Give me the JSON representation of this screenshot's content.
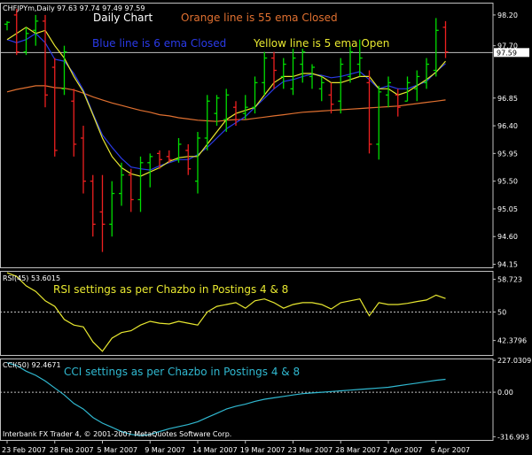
{
  "header": {
    "symbol_info": "CHFJPYm,Daily  97.63 97.74 97.49 97.59",
    "title": "Daily Chart",
    "notes": {
      "orange": "Orange line is 55 ema Closed",
      "blue": "Blue line is 6 ema Closed",
      "yellow": "Yellow line is 5 ema Open"
    }
  },
  "copyright": "Interbank FX Trader 4, © 2001-2007 MetaQuotes Software Corp.",
  "colors": {
    "background": "#000000",
    "up_bar": "#00dd00",
    "down_bar": "#ee2020",
    "ema55": "#e07030",
    "ema6": "#2a3ae8",
    "ema5_open": "#e8e830",
    "rsi": "#e8e830",
    "cci": "#30b8d0",
    "grid": "#c0c0c0",
    "frame": "#c0c0c0",
    "text": "#ffffff"
  },
  "chart_data": [
    {
      "type": "line",
      "title": "Daily Chart",
      "subtitle": "CHFJPYm,Daily  97.63 97.74 97.49 97.59",
      "ylim": [
        94.1,
        98.4
      ],
      "yticks": [
        98.2,
        97.7,
        96.85,
        96.4,
        95.95,
        95.5,
        95.05,
        94.6,
        94.15
      ],
      "ytick_labels": [
        "98.20",
        "97.70",
        "96.85",
        "96.40",
        "95.95",
        "95.50",
        "95.05",
        "94.60",
        "94.15"
      ],
      "current_price": 97.59,
      "current_price_label": "97.59",
      "xtick_labels": [
        {
          "label": "23 Feb 2007",
          "index": 0
        },
        {
          "label": "28 Feb 2007",
          "index": 5
        },
        {
          "label": "5 Mar 2007",
          "index": 10
        },
        {
          "label": "9 Mar 2007",
          "index": 15
        },
        {
          "label": "14 Mar 2007",
          "index": 20
        },
        {
          "label": "19 Mar 2007",
          "index": 25
        },
        {
          "label": "23 Mar 2007",
          "index": 30
        },
        {
          "label": "28 Mar 2007",
          "index": 35
        },
        {
          "label": "2 Apr 2007",
          "index": 40
        },
        {
          "label": "6 Apr 2007",
          "index": 45
        }
      ],
      "ohlc": [
        {
          "open": 98.05,
          "high": 98.1,
          "low": 97.95,
          "close": 98.08
        },
        {
          "open": 98.2,
          "high": 98.3,
          "low": 97.55,
          "close": 97.6
        },
        {
          "open": 97.6,
          "high": 98.0,
          "low": 97.55,
          "close": 97.9
        },
        {
          "open": 97.95,
          "high": 98.2,
          "low": 97.7,
          "close": 98.1
        },
        {
          "open": 98.1,
          "high": 98.2,
          "low": 96.7,
          "close": 96.9
        },
        {
          "open": 97.35,
          "high": 97.5,
          "low": 95.9,
          "close": 96.0
        },
        {
          "open": 97.0,
          "high": 97.7,
          "low": 96.9,
          "close": 97.6
        },
        {
          "open": 96.8,
          "high": 97.0,
          "low": 95.9,
          "close": 96.1
        },
        {
          "open": 96.2,
          "high": 96.4,
          "low": 95.3,
          "close": 95.5
        },
        {
          "open": 95.5,
          "high": 95.6,
          "low": 94.6,
          "close": 94.8
        },
        {
          "open": 95.0,
          "high": 95.6,
          "low": 94.35,
          "close": 94.8
        },
        {
          "open": 94.8,
          "high": 95.5,
          "low": 94.6,
          "close": 95.3
        },
        {
          "open": 95.3,
          "high": 95.8,
          "low": 95.1,
          "close": 95.6
        },
        {
          "open": 95.6,
          "high": 95.7,
          "low": 95.0,
          "close": 95.2
        },
        {
          "open": 95.2,
          "high": 95.9,
          "low": 95.0,
          "close": 95.8
        },
        {
          "open": 95.8,
          "high": 95.95,
          "low": 95.4,
          "close": 95.9
        },
        {
          "open": 95.95,
          "high": 96.0,
          "low": 95.7,
          "close": 95.85
        },
        {
          "open": 95.9,
          "high": 96.0,
          "low": 95.8,
          "close": 95.85
        },
        {
          "open": 95.85,
          "high": 96.2,
          "low": 95.8,
          "close": 96.1
        },
        {
          "open": 96.0,
          "high": 96.1,
          "low": 95.6,
          "close": 95.7
        },
        {
          "open": 95.5,
          "high": 96.3,
          "low": 95.3,
          "close": 96.2
        },
        {
          "open": 96.2,
          "high": 96.9,
          "low": 96.0,
          "close": 96.8
        },
        {
          "open": 96.6,
          "high": 96.9,
          "low": 96.4,
          "close": 96.85
        },
        {
          "open": 96.5,
          "high": 97.0,
          "low": 96.3,
          "close": 96.9
        },
        {
          "open": 96.7,
          "high": 96.8,
          "low": 96.4,
          "close": 96.5
        },
        {
          "open": 96.6,
          "high": 96.9,
          "low": 96.5,
          "close": 96.7
        },
        {
          "open": 96.7,
          "high": 97.2,
          "low": 96.6,
          "close": 97.1
        },
        {
          "open": 97.1,
          "high": 97.6,
          "low": 96.9,
          "close": 97.5
        },
        {
          "open": 97.5,
          "high": 97.6,
          "low": 97.0,
          "close": 97.3
        },
        {
          "open": 97.2,
          "high": 97.5,
          "low": 97.0,
          "close": 97.4
        },
        {
          "open": 97.0,
          "high": 97.65,
          "low": 96.9,
          "close": 97.5
        },
        {
          "open": 97.4,
          "high": 97.65,
          "low": 97.1,
          "close": 97.6
        },
        {
          "open": 97.2,
          "high": 97.4,
          "low": 97.0,
          "close": 97.35
        },
        {
          "open": 97.0,
          "high": 97.2,
          "low": 96.8,
          "close": 97.1
        },
        {
          "open": 96.9,
          "high": 97.1,
          "low": 96.6,
          "close": 96.75
        },
        {
          "open": 96.8,
          "high": 97.5,
          "low": 96.6,
          "close": 97.4
        },
        {
          "open": 97.2,
          "high": 97.7,
          "low": 97.1,
          "close": 97.6
        },
        {
          "open": 97.4,
          "high": 97.8,
          "low": 97.2,
          "close": 97.5
        },
        {
          "open": 97.1,
          "high": 97.3,
          "low": 95.95,
          "close": 96.1
        },
        {
          "open": 96.1,
          "high": 97.05,
          "low": 95.85,
          "close": 96.95
        },
        {
          "open": 96.9,
          "high": 97.2,
          "low": 96.7,
          "close": 97.1
        },
        {
          "open": 96.9,
          "high": 97.0,
          "low": 96.55,
          "close": 96.7
        },
        {
          "open": 96.8,
          "high": 97.2,
          "low": 96.8,
          "close": 97.1
        },
        {
          "open": 97.0,
          "high": 97.3,
          "low": 96.8,
          "close": 97.2
        },
        {
          "open": 97.1,
          "high": 97.5,
          "low": 97.0,
          "close": 97.4
        },
        {
          "open": 97.3,
          "high": 98.15,
          "low": 97.2,
          "close": 97.95
        },
        {
          "open": 98.0,
          "high": 98.1,
          "low": 97.5,
          "close": 97.6
        }
      ],
      "series": [
        {
          "name": "Orange line is 55 ema Closed",
          "values": [
            96.95,
            96.99,
            97.02,
            97.05,
            97.05,
            97.02,
            97.01,
            96.98,
            96.93,
            96.87,
            96.82,
            96.77,
            96.73,
            96.69,
            96.65,
            96.62,
            96.58,
            96.56,
            96.53,
            96.51,
            96.49,
            96.48,
            96.47,
            96.49,
            96.5,
            96.5,
            96.52,
            96.54,
            96.56,
            96.58,
            96.6,
            96.62,
            96.63,
            96.64,
            96.65,
            96.66,
            96.67,
            96.68,
            96.69,
            96.7,
            96.71,
            96.72,
            96.74,
            96.76,
            96.78,
            96.8,
            96.82
          ]
        },
        {
          "name": "Blue line is 6 ema Closed",
          "values": [
            97.8,
            97.75,
            97.8,
            97.9,
            97.75,
            97.48,
            97.45,
            97.25,
            96.98,
            96.6,
            96.25,
            96.05,
            95.87,
            95.73,
            95.7,
            95.68,
            95.75,
            95.8,
            95.85,
            95.85,
            95.93,
            96.05,
            96.2,
            96.35,
            96.45,
            96.55,
            96.7,
            96.85,
            97.0,
            97.12,
            97.15,
            97.2,
            97.24,
            97.22,
            97.18,
            97.2,
            97.24,
            97.28,
            97.15,
            97.0,
            97.05,
            97.0,
            97.0,
            97.06,
            97.12,
            97.28,
            97.41
          ]
        },
        {
          "name": "Yellow line is 5 ema Open",
          "values": [
            97.8,
            97.9,
            98.0,
            97.9,
            97.95,
            97.7,
            97.5,
            97.2,
            96.95,
            96.58,
            96.2,
            95.9,
            95.72,
            95.62,
            95.58,
            95.65,
            95.72,
            95.82,
            95.88,
            95.9,
            95.9,
            96.1,
            96.3,
            96.5,
            96.6,
            96.65,
            96.7,
            96.9,
            97.1,
            97.2,
            97.2,
            97.25,
            97.25,
            97.2,
            97.1,
            97.1,
            97.15,
            97.2,
            97.2,
            97.0,
            97.0,
            96.9,
            96.95,
            97.05,
            97.15,
            97.27,
            97.45
          ]
        }
      ]
    },
    {
      "type": "line",
      "title": "RSI settings as per Chazbo in Postings 4 & 8",
      "subtitle": "RSI(45) 53.6015",
      "ylim": [
        38.5,
        61.0
      ],
      "yticks": [
        58.723,
        50,
        42.3796
      ],
      "ytick_labels": [
        "58.723",
        "50",
        "42.3796"
      ],
      "series": [
        {
          "name": "RSI(45)",
          "values": [
            60.5,
            59.5,
            57.0,
            55.5,
            53.0,
            51.5,
            48.0,
            46.5,
            46.0,
            42.0,
            39.5,
            43.0,
            44.5,
            45.0,
            46.5,
            47.5,
            47.0,
            46.8,
            47.5,
            47.0,
            46.5,
            50.0,
            51.5,
            52.0,
            52.5,
            51.0,
            53.0,
            53.5,
            52.5,
            51.0,
            52.0,
            52.5,
            52.5,
            52.0,
            50.8,
            52.5,
            53.0,
            53.5,
            49.0,
            52.5,
            52.0,
            52.0,
            52.3,
            52.8,
            53.2,
            54.5,
            53.6
          ]
        }
      ]
    },
    {
      "type": "line",
      "title": "CCI settings as per Chazbo in Postings 4 & 8",
      "subtitle": "CCI(50) 92.4671",
      "ylim": [
        -340,
        240
      ],
      "yticks": [
        227.0309,
        0,
        -316.993
      ],
      "ytick_labels": [
        "227.0309",
        "0.00",
        "-316.993"
      ],
      "series": [
        {
          "name": "CCI(50)",
          "values": [
            210.0,
            190.0,
            150.0,
            120.0,
            80.0,
            30.0,
            -20.0,
            -80.0,
            -120.0,
            -180.0,
            -220.0,
            -250.0,
            -280.0,
            -300.0,
            -310.0,
            -300.0,
            -280.0,
            -260.0,
            -245.0,
            -230.0,
            -210.0,
            -180.0,
            -150.0,
            -120.0,
            -100.0,
            -85.0,
            -65.0,
            -50.0,
            -40.0,
            -30.0,
            -20.0,
            -10.0,
            -5.0,
            0.0,
            5.0,
            10.0,
            15.0,
            20.0,
            25.0,
            30.0,
            35.0,
            45.0,
            55.0,
            65.0,
            75.0,
            85.0,
            92.0
          ]
        }
      ]
    }
  ]
}
